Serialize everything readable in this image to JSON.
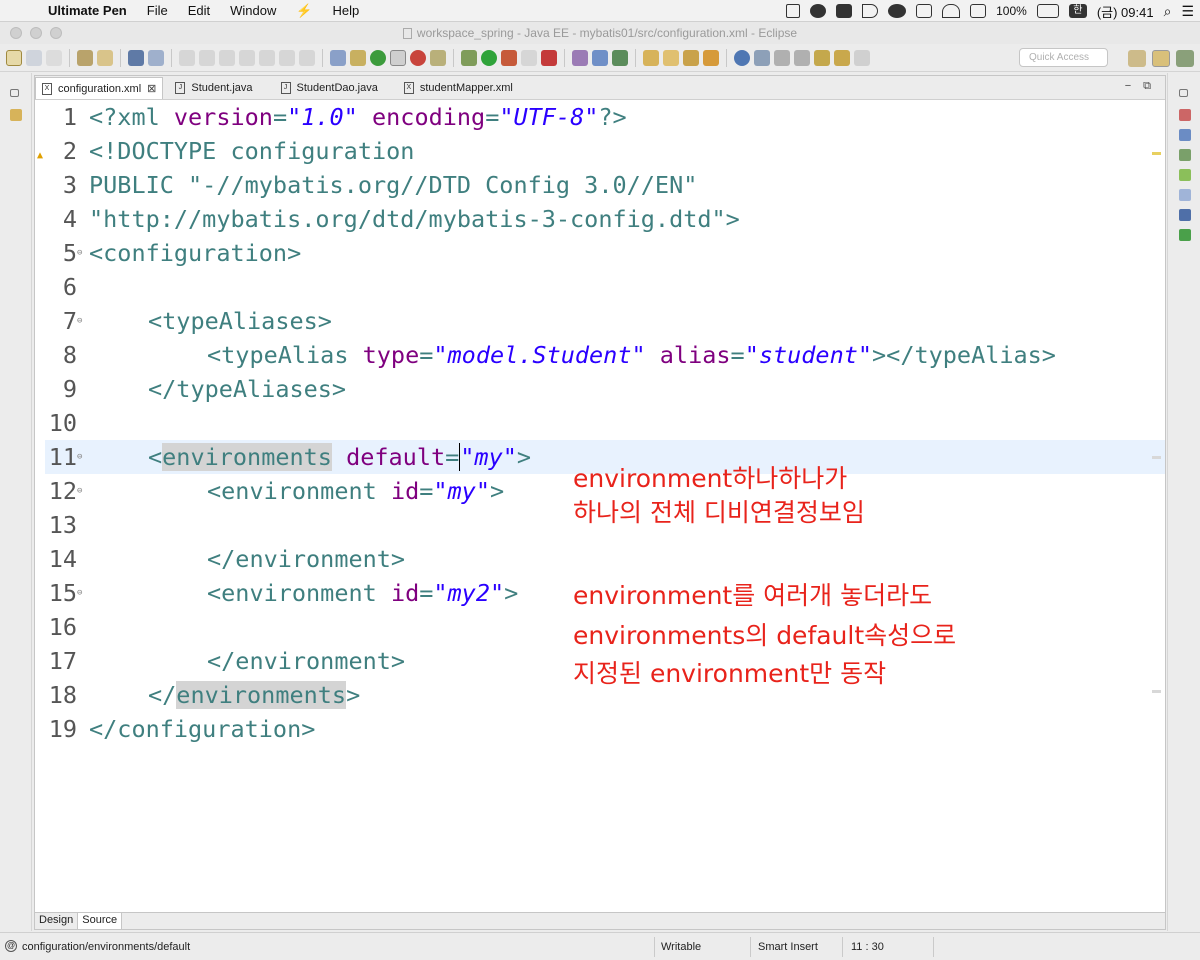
{
  "menubar": {
    "app_name": "Ultimate Pen",
    "items": [
      "File",
      "Edit",
      "Window",
      "Help"
    ],
    "battery": "100%",
    "input_source": "한",
    "clock": "(금) 09:41"
  },
  "window": {
    "title": "workspace_spring - Java EE - mybatis01/src/configuration.xml - Eclipse"
  },
  "toolbar": {
    "quick_access_placeholder": "Quick Access"
  },
  "editor": {
    "tabs": [
      {
        "label": "configuration.xml",
        "icon": "X",
        "active": true
      },
      {
        "label": "Student.java",
        "icon": "J",
        "active": false
      },
      {
        "label": "StudentDao.java",
        "icon": "J",
        "active": false
      },
      {
        "label": "studentMapper.xml",
        "icon": "X",
        "active": false
      }
    ],
    "line_numbers": [
      "1",
      "2",
      "3",
      "4",
      "5",
      "6",
      "7",
      "8",
      "9",
      "10",
      "11",
      "12",
      "13",
      "14",
      "15",
      "16",
      "17",
      "18",
      "19"
    ],
    "code": {
      "l1": {
        "a": "<?xml ",
        "b": "version",
        "c": "=",
        "d": "\"1.0\"",
        "e": " ",
        "f": "encoding",
        "g": "=",
        "h": "\"UTF-8\"",
        "i": "?>"
      },
      "l2": "<!DOCTYPE configuration",
      "l3": "PUBLIC \"-//mybatis.org//DTD Config 3.0//EN\"",
      "l4": "\"http://mybatis.org/dtd/mybatis-3-config.dtd\">",
      "l5": "<configuration>",
      "l7": "<typeAliases>",
      "l8": {
        "a": "<typeAlias ",
        "b": "type",
        "c": "=",
        "d": "\"model.Student\"",
        "e": " ",
        "f": "alias",
        "g": "=",
        "h": "\"student\"",
        "i": "></typeAlias>"
      },
      "l9": "</typeAliases>",
      "l11": {
        "a": "<",
        "b": "environments",
        "c": " default",
        "d": "=",
        "e": "\"my\"",
        "f": ">"
      },
      "l12": {
        "a": "<environment ",
        "b": "id",
        "c": "=",
        "d": "\"my\"",
        "e": ">"
      },
      "l14": "</environment>",
      "l15": {
        "a": "<environment ",
        "b": "id",
        "c": "=",
        "d": "\"my2\"",
        "e": ">"
      },
      "l17": "</environment>",
      "l18": {
        "a": "</",
        "b": "environments",
        "c": ">"
      },
      "l19": "</configuration>"
    },
    "annotations": [
      "environment하나하나가",
      "하나의 전체 디비연결정보임",
      "environment를 여러개 놓더라도",
      "environments의 default속성으로",
      "지정된 environment만 동작"
    ],
    "bottom_tabs": [
      "Design",
      "Source"
    ],
    "active_bottom_tab": "Source"
  },
  "statusbar": {
    "path": "configuration/environments/default",
    "mode": "Writable",
    "insert": "Smart Insert",
    "position": "11 : 30"
  }
}
